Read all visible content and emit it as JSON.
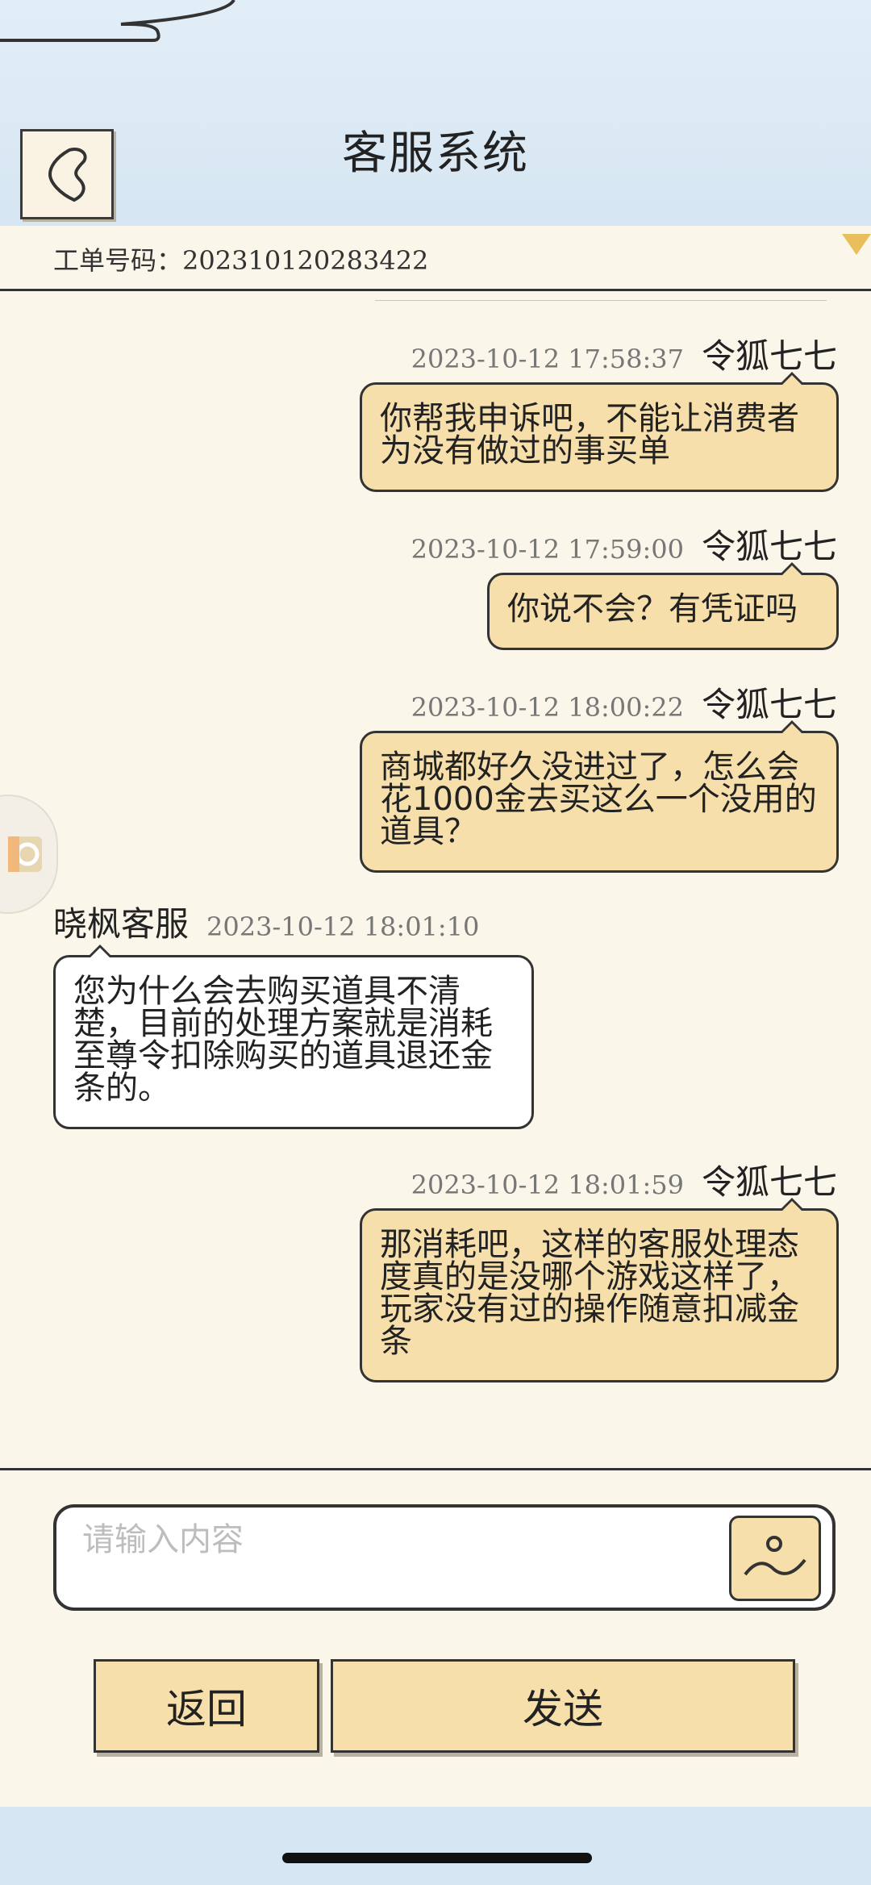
{
  "header": {
    "title": "客服系统",
    "back_icon": "chevron-left-icon"
  },
  "ticket": {
    "label": "工单号码：",
    "number": "202310120283422"
  },
  "messages": [
    {
      "sender": "令狐七七",
      "time": "2023-10-12 17:58:37",
      "text": "你帮我申诉吧，不能让消费者为没有做过的事买单"
    },
    {
      "sender": "令狐七七",
      "time": "2023-10-12 17:59:00",
      "text": "你说不会？有凭证吗"
    },
    {
      "sender": "令狐七七",
      "time": "2023-10-12 18:00:22",
      "text": "商城都好久没进过了，怎么会花1000金去买这么一个没用的道具？"
    },
    {
      "sender": "晓枫客服",
      "time": "2023-10-12 18:01:10",
      "text": "您为什么会去购买道具不清楚，目前的处理方案就是消耗至尊令扣除购买的道具退还金条的。"
    },
    {
      "sender": "令狐七七",
      "time": "2023-10-12 18:01:59",
      "text": "那消耗吧，这样的客服处理态度真的是没哪个游戏这样了，玩家没有过的操作随意扣减金条"
    }
  ],
  "composer": {
    "placeholder": "请输入内容",
    "value": "",
    "image_icon": "image-icon"
  },
  "buttons": {
    "back": "返回",
    "send": "发送"
  },
  "colors": {
    "header_bg": "#dbe9f4",
    "paper_bg": "#fbf6ea",
    "user_bubble": "#f6dfaa",
    "agent_bubble": "#ffffff",
    "accent": "#e9bf5e"
  }
}
